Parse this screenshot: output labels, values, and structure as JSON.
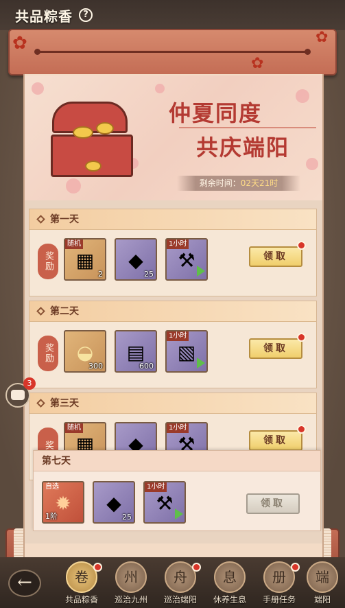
{
  "header": {
    "title": "共品粽香",
    "help_icon": "?"
  },
  "banner": {
    "slogan_line1": "仲夏同度",
    "slogan_line2": "共庆端阳",
    "timer_label": "剩余时间：",
    "timer_value": "02天21时"
  },
  "days": [
    {
      "title": "第一天",
      "reward_label": "奖励",
      "items": [
        {
          "icon": "treasure-chest-icon",
          "tag": "随机",
          "count": "2",
          "color": "gold"
        },
        {
          "icon": "stone-ore-icon",
          "tag": "",
          "count": "25",
          "color": "purple"
        },
        {
          "icon": "speedup-hammer-icon",
          "tag": "1小时",
          "count": "",
          "color": "purple"
        }
      ],
      "claim_label": "领取",
      "claimable": true
    },
    {
      "title": "第二天",
      "reward_label": "奖励",
      "items": [
        {
          "icon": "gold-ingot-icon",
          "tag": "",
          "count": "300",
          "color": "gold"
        },
        {
          "icon": "book-scroll-icon",
          "tag": "",
          "count": "600",
          "color": "purple"
        },
        {
          "icon": "speedup-scroll-icon",
          "tag": "1小时",
          "count": "",
          "color": "purple"
        }
      ],
      "claim_label": "领取",
      "claimable": true
    },
    {
      "title": "第三天",
      "reward_label": "奖",
      "items": [
        {
          "icon": "treasure-chest-icon",
          "tag": "随机",
          "count": "",
          "color": "gold"
        },
        {
          "icon": "stone-ore-icon",
          "tag": "",
          "count": "",
          "color": "purple"
        },
        {
          "icon": "speedup-icon",
          "tag": "1小时",
          "count": "",
          "color": "purple"
        }
      ],
      "claim_label": "领取",
      "claimable": true
    }
  ],
  "day7": {
    "title": "第七天",
    "items": [
      {
        "icon": "red-crystal-icon",
        "tag": "自选",
        "count": "1阶",
        "color": "red"
      },
      {
        "icon": "stone-ore-icon",
        "tag": "",
        "count": "25",
        "color": "purple"
      },
      {
        "icon": "speedup-hammer-icon",
        "tag": "1小时",
        "count": "",
        "color": "purple"
      }
    ],
    "claim_label": "领取",
    "claimable": false
  },
  "chat": {
    "badge": "3"
  },
  "nav": {
    "back_icon": "←",
    "tabs": [
      {
        "label": "共品粽香",
        "icon": "卷",
        "active": true
      },
      {
        "label": "巡治九州",
        "icon": "州",
        "active": false
      },
      {
        "label": "巡治端阳",
        "icon": "舟",
        "active": false
      },
      {
        "label": "休养生息",
        "icon": "息",
        "active": false
      },
      {
        "label": "手册任务",
        "icon": "册",
        "active": false
      },
      {
        "label": "端阳",
        "icon": "端",
        "active": false
      }
    ]
  },
  "colors": {
    "accent_red": "#b43a32",
    "notify_dot": "#d8362a",
    "claim_gold": "#f0cf6c"
  }
}
